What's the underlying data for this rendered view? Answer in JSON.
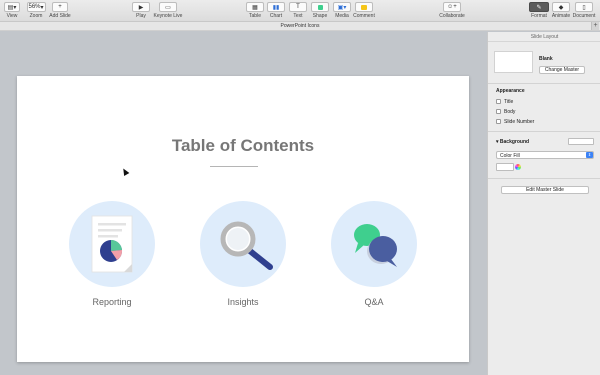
{
  "toolbar": {
    "view": "View",
    "zoom_value": "56%",
    "zoom": "Zoom",
    "add_slide": "Add Slide",
    "play": "Play",
    "keynote_live": "Keynote Live",
    "table": "Table",
    "chart": "Chart",
    "text": "Text",
    "shape": "Shape",
    "media": "Media",
    "comment": "Comment",
    "collaborate": "Collaborate",
    "format": "Format",
    "animate": "Animate",
    "document": "Document"
  },
  "document_title": "PowerPoint Icons",
  "slide": {
    "title": "Table of Contents",
    "items": [
      {
        "label": "Reporting",
        "icon": "report-icon"
      },
      {
        "label": "Insights",
        "icon": "magnifier-icon"
      },
      {
        "label": "Q&A",
        "icon": "speech-bubbles-icon"
      }
    ]
  },
  "inspector": {
    "header": "Slide Layout",
    "layout_name": "Blank",
    "change_master": "Change Master",
    "appearance": "Appearance",
    "checkboxes": [
      {
        "label": "Title",
        "checked": false
      },
      {
        "label": "Body",
        "checked": false
      },
      {
        "label": "Slide Number",
        "checked": false
      }
    ],
    "background": "Background",
    "fill_type": "Color Fill",
    "edit_master": "Edit Master Slide"
  },
  "colors": {
    "accent_blue": "#3b82f6",
    "circle_bg": "#deecfb",
    "pie_navy": "#2f3f8f",
    "pie_green": "#58c79a",
    "pie_pink": "#f2a0a8",
    "bubble_green": "#3fcf8e",
    "bubble_navy": "#4a5ea0"
  }
}
